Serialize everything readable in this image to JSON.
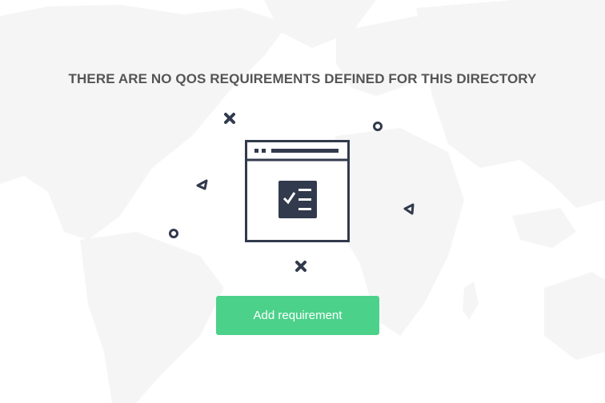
{
  "empty_state": {
    "title": "THERE ARE NO QOS REQUIREMENTS DEFINED FOR THIS DIRECTORY",
    "illustration_icon": "browser-window-checklist-icon",
    "decorations": [
      "x-mark-icon",
      "circle-icon",
      "triangle-icon",
      "circle-icon",
      "triangle-icon",
      "x-mark-icon"
    ]
  },
  "actions": {
    "add_requirement_label": "Add requirement"
  },
  "colors": {
    "background": "#ffffff",
    "map_land": "#f5f5f5",
    "title_text": "#555555",
    "illustration_stroke": "#323a4d",
    "button_background": "#4cd18b",
    "button_text": "#ffffff"
  }
}
